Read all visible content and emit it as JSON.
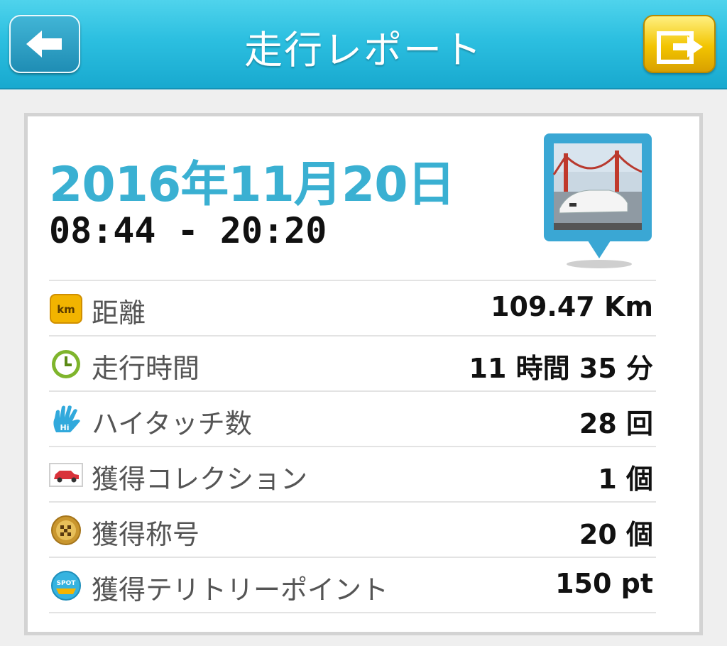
{
  "header": {
    "title": "走行レポート",
    "back_icon": "arrow-left-icon",
    "share_icon": "share-arrow-icon"
  },
  "report": {
    "date": "2016年11月20日",
    "time_range": "08:44 - 20:20"
  },
  "stats": [
    {
      "icon": "km-icon",
      "label": "距離",
      "value": "109.47 Km"
    },
    {
      "icon": "clock-icon",
      "label": "走行時間",
      "value": "11 時間 35 分"
    },
    {
      "icon": "hand-hi-icon",
      "label": "ハイタッチ数",
      "value": "28 回"
    },
    {
      "icon": "car-icon",
      "label": "獲得コレクション",
      "value": "1 個"
    },
    {
      "icon": "medal-icon",
      "label": "獲得称号",
      "value": "20 個"
    },
    {
      "icon": "spot-icon",
      "label": "獲得テリトリーポイント",
      "value": "150 pt"
    }
  ],
  "colors": {
    "header_blue": "#2cbfe0",
    "date_blue": "#3ab0d2",
    "share_yellow": "#f2c400"
  }
}
